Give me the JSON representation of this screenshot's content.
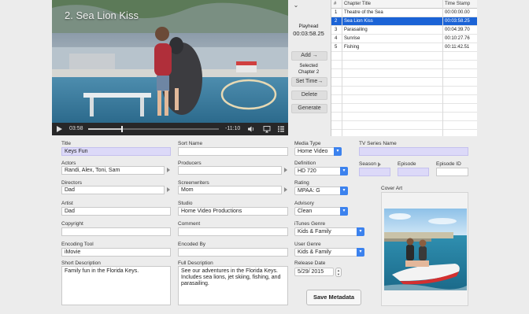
{
  "video": {
    "title": "2. Sea Lion Kiss",
    "elapsed": "03:58",
    "remaining": "-11:10",
    "progress": 0.26
  },
  "playhead": {
    "label": "Playhead",
    "time": "00:03:58.25"
  },
  "chapter_controls": {
    "add": "Add →",
    "selected": "Selected",
    "selected_chapter": "Chapter 2",
    "set_time": "Set Time→",
    "delete": "Delete",
    "generate": "Generate"
  },
  "chapters": {
    "headers": [
      "#",
      "Chapter Title",
      "Time Stamp"
    ],
    "rows": [
      {
        "num": "1",
        "title": "Theatre of the Sea",
        "time": "00:00:00.00"
      },
      {
        "num": "2",
        "title": "Sea Lion Kiss",
        "time": "00:03:58.25"
      },
      {
        "num": "3",
        "title": "Parasailing",
        "time": "00:04:39.70"
      },
      {
        "num": "4",
        "title": "Sunrise",
        "time": "00:10:27.76"
      },
      {
        "num": "5",
        "title": "Fishing",
        "time": "00:11:42.51"
      }
    ],
    "selected_index": 1
  },
  "form": {
    "title": {
      "label": "Title",
      "value": "Keys Fun"
    },
    "sort_name": {
      "label": "Sort Name",
      "value": ""
    },
    "media_type": {
      "label": "Media Type",
      "value": "Home Video"
    },
    "tv_series_name": {
      "label": "TV Series Name",
      "value": ""
    },
    "actors": {
      "label": "Actors",
      "value": "Randi, Alex, Toni, Sam"
    },
    "producers": {
      "label": "Producers",
      "value": ""
    },
    "definition": {
      "label": "Definition",
      "value": "HD 720"
    },
    "season": {
      "label": "Season",
      "value": ""
    },
    "episode": {
      "label": "Episode",
      "value": ""
    },
    "episode_id": {
      "label": "Episode ID",
      "value": ""
    },
    "directors": {
      "label": "Directors",
      "value": "Dad"
    },
    "screenwriters": {
      "label": "Screenwriters",
      "value": "Mom"
    },
    "rating": {
      "label": "Rating",
      "value": "MPAA: G"
    },
    "cover_art": {
      "label": "Cover Art"
    },
    "artist": {
      "label": "Artist",
      "value": "Dad"
    },
    "studio": {
      "label": "Studio",
      "value": "Home Video Productions"
    },
    "advisory": {
      "label": "Advisory",
      "value": "Clean"
    },
    "copyright": {
      "label": "Copyright",
      "value": ""
    },
    "comment": {
      "label": "Comment",
      "value": ""
    },
    "itunes_genre": {
      "label": "iTunes Genre",
      "value": "Kids & Family"
    },
    "encoding_tool": {
      "label": "Encoding Tool",
      "value": "iMovie"
    },
    "encoded_by": {
      "label": "Encoded By",
      "value": ""
    },
    "user_genre": {
      "label": "User Genre",
      "value": "Kids & Family"
    },
    "short_description": {
      "label": "Short Description",
      "value": "Family fun in the Florida Keys."
    },
    "full_description": {
      "label": "Full Description",
      "value": "See our adventures in the Florida Keys. Includes sea lions, jet skiing, fishing, and parasailing."
    },
    "release_date": {
      "label": "Release Date",
      "value": "5/29/ 2015"
    },
    "save_button": "Save Metadata"
  },
  "colors": {
    "selection": "#1b63d6",
    "highlight_field": "#dcd9f8",
    "popup_accent": "#3c82ee"
  },
  "icons": [
    "play-icon",
    "volume-icon",
    "airplay-icon",
    "chapters-icon",
    "dropdown-chevron-icon"
  ]
}
